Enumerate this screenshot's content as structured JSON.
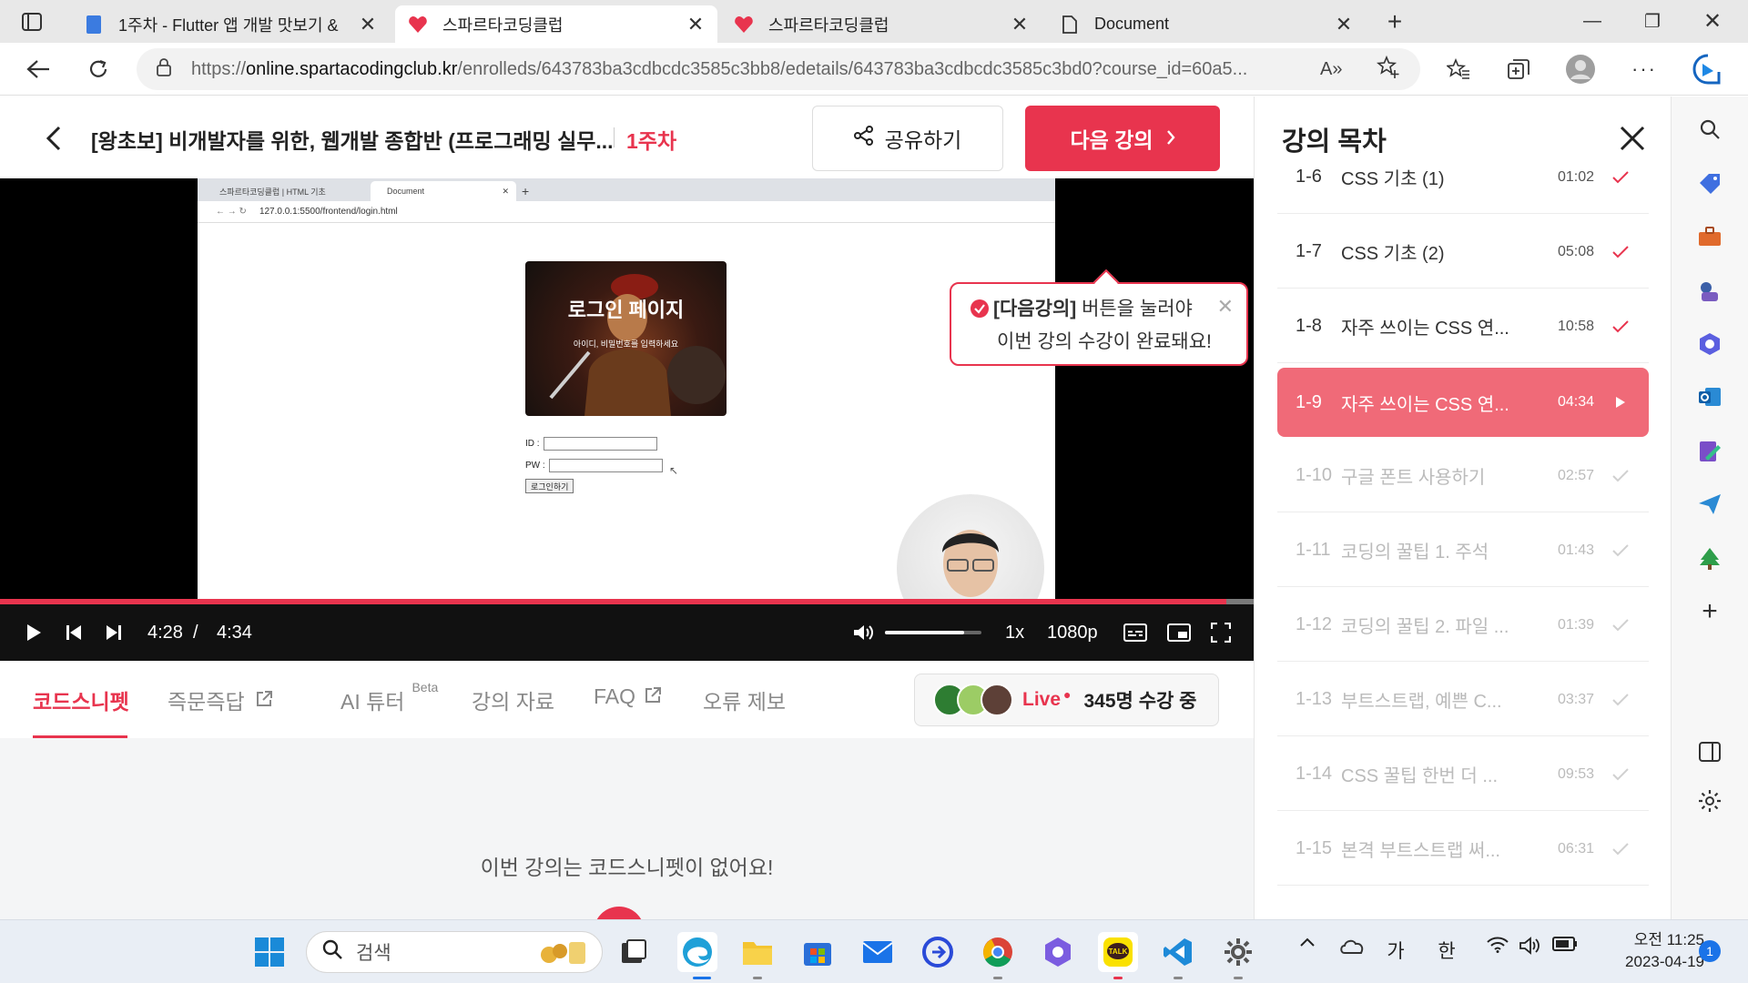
{
  "browser": {
    "tabs": [
      {
        "title": "1주차 - Flutter 앱 개발 맛보기 &",
        "active": false
      },
      {
        "title": "스파르타코딩클럽",
        "active": true
      },
      {
        "title": "스파르타코딩클럽",
        "active": false
      },
      {
        "title": "Document",
        "active": false
      }
    ],
    "url_host": "online.spartacodingclub.kr",
    "url_prefix": "https://",
    "url_path": "/enrolleds/643783ba3cdbcdc3585c3bb8/edetails/643783ba3cdbcdc3585c3bd0?course_id=60a5..."
  },
  "lecture": {
    "title": "[왕초보] 비개발자를 위한, 웹개발 종합반 (프로그래밍 실무...",
    "week": "1주차",
    "share_label": "공유하기",
    "next_label": "다음 강의"
  },
  "tooltip": {
    "highlight": "[다음강의]",
    "line1_rest": " 버튼을 눌러야",
    "line2": "이번 강의 수강이 완료돼요!"
  },
  "video_content": {
    "tab1": "스파르타코딩클럽 | HTML 기초",
    "tab2": "Document",
    "address": "127.0.0.1:5500/frontend/login.html",
    "login_title": "로그인 페이지",
    "login_subtitle": "아이디, 비밀번호를 입력하세요",
    "id_label": "ID :",
    "pw_label": "PW :",
    "login_button": "로그인하기"
  },
  "player": {
    "current_time": "4:28",
    "separator": "/",
    "duration": "4:34",
    "progress": 0.978,
    "volume": 0.82,
    "speed": "1x",
    "quality": "1080p"
  },
  "info_tabs": [
    {
      "label": "코드스니펫",
      "active": true,
      "external": false
    },
    {
      "label": "즉문즉답",
      "active": false,
      "external": true
    },
    {
      "label": "AI 튜터",
      "active": false,
      "external": false,
      "badge": "Beta"
    },
    {
      "label": "강의 자료",
      "active": false,
      "external": false
    },
    {
      "label": "FAQ",
      "active": false,
      "external": true
    },
    {
      "label": "오류 제보",
      "active": false,
      "external": false
    }
  ],
  "live": {
    "label": "Live",
    "count": "345명 수강 중"
  },
  "empty_message": "이번 강의는 코드스니펫이 없어요!",
  "sidebar": {
    "title": "강의 목차",
    "items": [
      {
        "num": "1-6",
        "name": "CSS 기초 (1)",
        "duration": "01:02",
        "state": "done"
      },
      {
        "num": "1-7",
        "name": "CSS 기초 (2)",
        "duration": "05:08",
        "state": "done"
      },
      {
        "num": "1-8",
        "name": "자주 쓰이는 CSS 연...",
        "duration": "10:58",
        "state": "done"
      },
      {
        "num": "1-9",
        "name": "자주 쓰이는 CSS 연...",
        "duration": "04:34",
        "state": "current"
      },
      {
        "num": "1-10",
        "name": "구글 폰트 사용하기",
        "duration": "02:57",
        "state": "todo"
      },
      {
        "num": "1-11",
        "name": "코딩의 꿀팁 1. 주석",
        "duration": "01:43",
        "state": "todo"
      },
      {
        "num": "1-12",
        "name": "코딩의 꿀팁 2. 파일 ...",
        "duration": "01:39",
        "state": "todo"
      },
      {
        "num": "1-13",
        "name": "부트스트랩, 예쁜 C...",
        "duration": "03:37",
        "state": "todo"
      },
      {
        "num": "1-14",
        "name": "CSS 꿀팁 한번 더 ...",
        "duration": "09:53",
        "state": "todo"
      },
      {
        "num": "1-15",
        "name": "본격 부트스트랩 써...",
        "duration": "06:31",
        "state": "todo"
      }
    ]
  },
  "taskbar": {
    "search_placeholder": "검색",
    "ime_1": "가",
    "ime_2": "한",
    "time": "오전 11:25",
    "date": "2023-04-19",
    "notifications": "1"
  },
  "colors": {
    "brand": "#e8344e",
    "current_item": "#f06a78"
  }
}
